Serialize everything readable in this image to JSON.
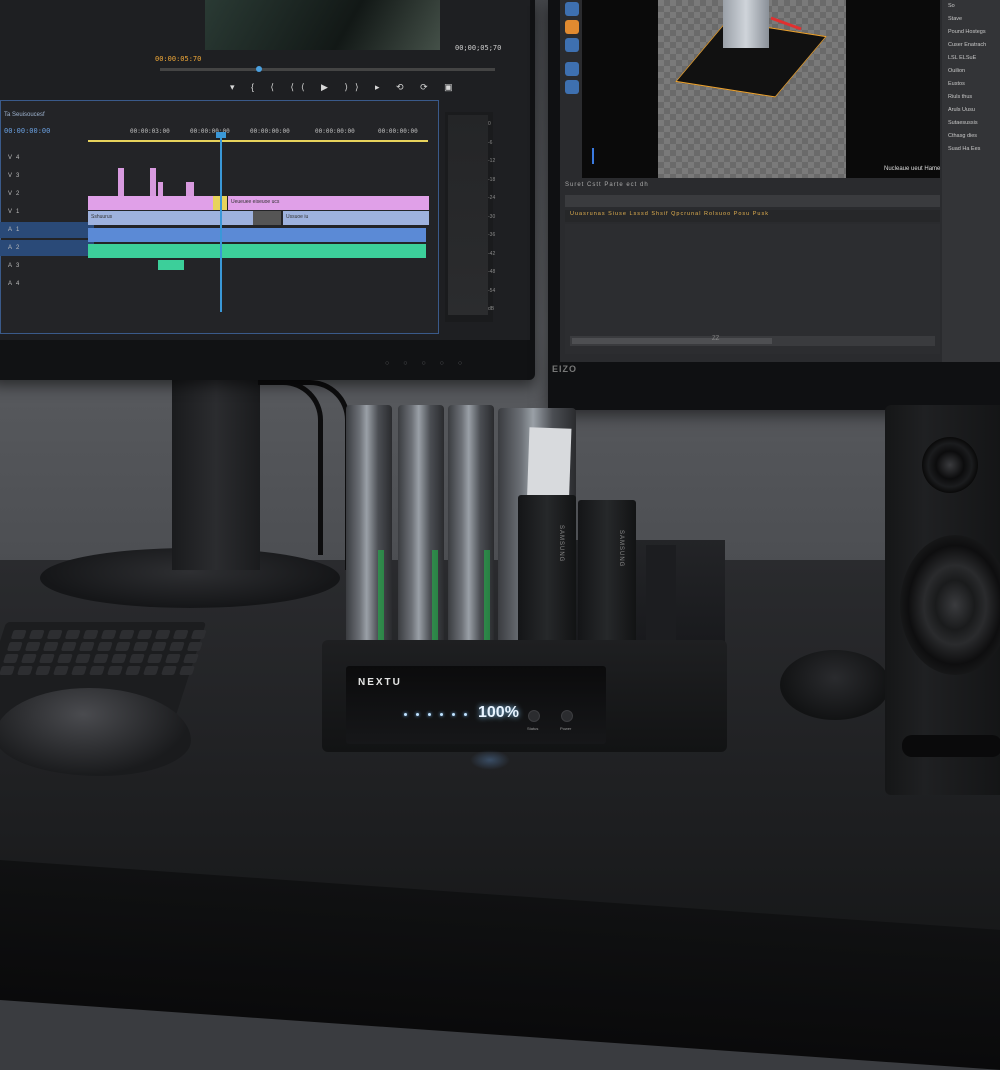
{
  "scene": {
    "left_monitor": {
      "timecode_top": "00;00;05;70",
      "timecode_small": "00:00:05:70",
      "timeline_tab": "Ta Seuisoucesf",
      "timeline_timecode": "00:00:00:00",
      "ruler_marks": [
        "00:00:03:00",
        "00:00:00:00",
        "00:00:00:00",
        "00:00:00:00",
        "00:00:00:00"
      ],
      "transport_glyphs": "▾ { ⟨ ⟨⟨ ▶ ⟩⟩ ▸ ⟲ ⟳ ▣",
      "clip_labels": [
        "Ueueuee eiseuoe ucs",
        "Sshuurus",
        "Ussuoe iu"
      ],
      "track_icons": [
        "V4",
        "V3",
        "V2",
        "V1",
        "A1",
        "A2",
        "A3",
        "A4"
      ],
      "meter_ticks": [
        "0",
        "-6",
        "-12",
        "-18",
        "-24",
        "-30",
        "-36",
        "-42",
        "-48",
        "-54",
        "dB"
      ]
    },
    "right_monitor": {
      "brand": "EIZO",
      "viewport_caption": "Nucleaue ueut Hame",
      "tabs": "Suret Cstt  Parte  ect dh",
      "columns": [
        "Uuasrunas",
        "Siuse",
        "Lsssd",
        "Shsif",
        "Qpcrunal",
        "Rolsuoo",
        "Posu",
        "Pusk"
      ],
      "scroll_label": "ZZ",
      "props": [
        "So",
        "Stave",
        "Pound Hostegs",
        "Cuser Enatrach",
        "",
        "LSL ELSuE",
        "Ouilion",
        "Eustos",
        "Riuls thus",
        "Aruls Uusu",
        "Sutaesussis",
        "Cthasg dies",
        "Suad Ha Ees"
      ]
    },
    "dock": {
      "brand": "NEXTU",
      "progress_text": "100%",
      "progress": 100,
      "button_labels": [
        "Status",
        "Power"
      ],
      "ssd_labels": [
        "SAMSUNG",
        "SAMSUNG"
      ]
    }
  }
}
